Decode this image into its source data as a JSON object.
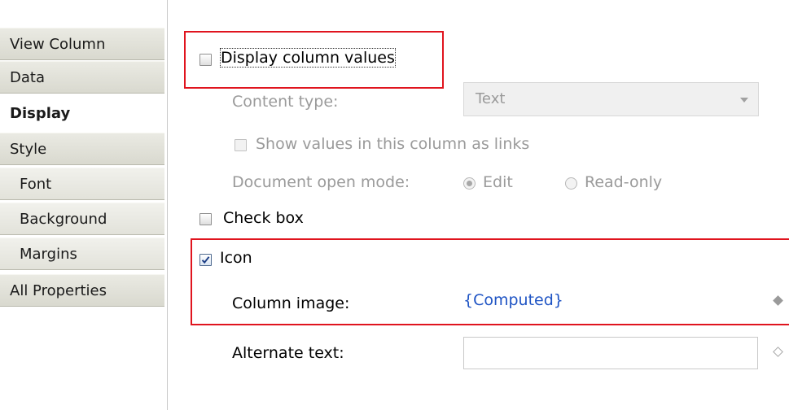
{
  "nav": {
    "items": [
      {
        "label": "View Column"
      },
      {
        "label": "Data"
      },
      {
        "label": "Display"
      },
      {
        "label": "Style"
      },
      {
        "label": "Font"
      },
      {
        "label": "Background"
      },
      {
        "label": "Margins"
      },
      {
        "label": "All Properties"
      }
    ],
    "active": "Display"
  },
  "display": {
    "display_values": {
      "label": "Display column values",
      "checked": false
    },
    "content_type": {
      "label": "Content type:",
      "value": "Text"
    },
    "show_as_links": {
      "label": "Show values in this column as links",
      "checked": false
    },
    "open_mode": {
      "label": "Document open mode:",
      "options": [
        "Edit",
        "Read-only"
      ],
      "selected": "Edit"
    },
    "check_box": {
      "label": "Check box",
      "checked": false
    },
    "icon": {
      "label": "Icon",
      "checked": true
    },
    "column_image": {
      "label": "Column image:",
      "value": "{Computed}"
    },
    "alternate_text": {
      "label": "Alternate text:",
      "value": ""
    }
  },
  "colors": {
    "highlight": "#e0141e",
    "link": "#1f54c4"
  },
  "icons": {
    "computed_marker": "diamond-filled-icon",
    "formula_marker": "diamond-outline-icon"
  }
}
